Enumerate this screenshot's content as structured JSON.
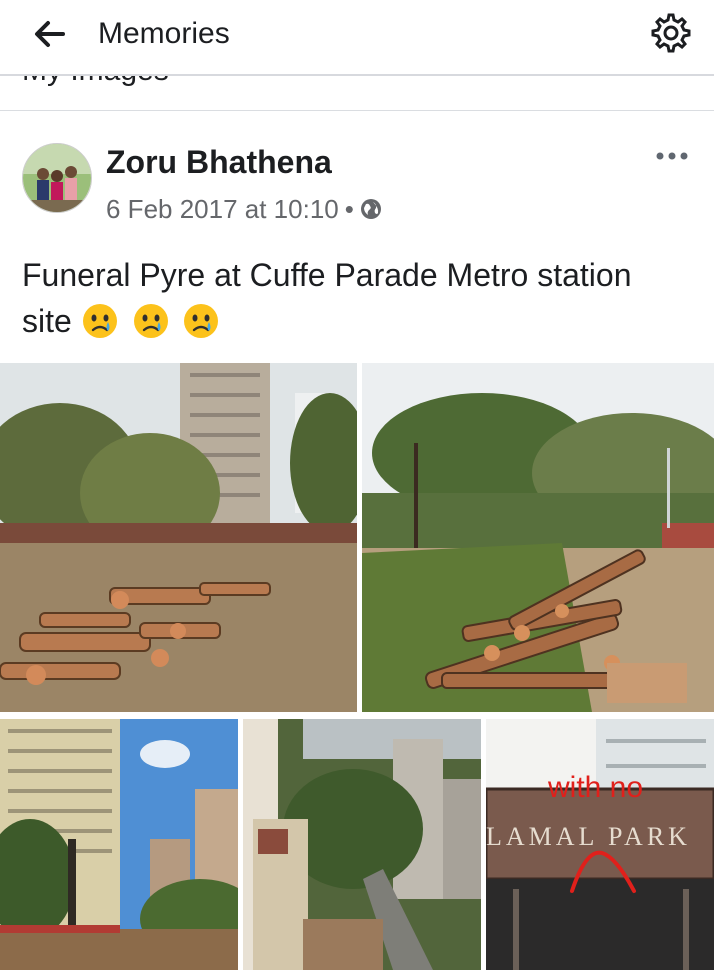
{
  "header": {
    "title": "Memories",
    "back_icon": "arrow-left-icon",
    "settings_icon": "gear-icon"
  },
  "peek_text": "My Images",
  "post": {
    "author": "Zoru Bhathena",
    "timestamp": "6 Feb 2017 at 10:10",
    "separator": "•",
    "privacy_icon": "globe-icon",
    "more_icon": "more-dots-icon",
    "text": "Funeral Pyre at Cuffe Parade Metro station site",
    "emojis": [
      "crying-face",
      "crying-face",
      "crying-face"
    ]
  },
  "photos": {
    "sign_overlay_text": "with no",
    "sign_text": "LAMAL PARK"
  },
  "colors": {
    "text": "#1c1e21",
    "secondary": "#65676b",
    "divider": "#dadde1",
    "annotation_red": "#e0201b"
  }
}
